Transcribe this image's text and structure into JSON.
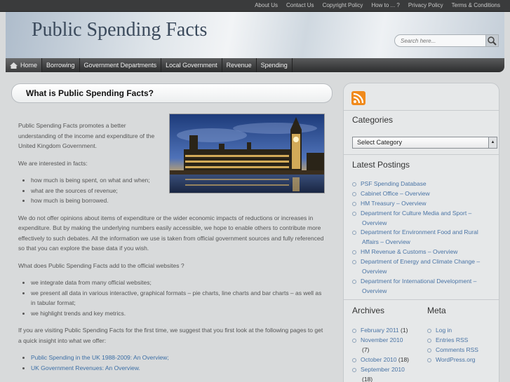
{
  "topnav": [
    "About Us",
    "Contact Us",
    "Copyright Policy",
    "How to ... ?",
    "Privacy Policy",
    "Terms & Conditions"
  ],
  "site": {
    "title": "Public Spending Facts"
  },
  "search": {
    "placeholder": "Search here..."
  },
  "mainnav": [
    "Home",
    "Borrowing",
    "Government Departments",
    "Local Government",
    "Revenue",
    "Spending"
  ],
  "content": {
    "heading": "What is Public Spending Facts?",
    "p1": "Public Spending Facts promotes a better understanding of the income and expenditure of the United Kingdom Government.",
    "p2": "We are interested in facts:",
    "facts": [
      "how much is being spent, on what and when;",
      "what are the sources of revenue;",
      "how much is being borrowed."
    ],
    "p3": "We do not offer opinions about items of expenditure or the wider economic impacts of reductions or increases in expenditure. But by making the underlying numbers easily accessible, we hope to enable others to contribute more effectively to such debates. All the information we use is taken from official government sources and fully referenced so that you can explore the base data if you wish.",
    "p4": "What does Public Spending Facts add to the official websites ?",
    "adds": [
      "we integrate data from many official websites;",
      "we present all data in various interactive, graphical formats – pie charts, line charts and bar charts – as well as in tabular format;",
      "we highlight trends and key metrics."
    ],
    "p5": "If you are visiting Public Spending Facts for the first time, we suggest that you first look at the following pages to get a quick insight into what we offer:",
    "links": [
      "Public Spending in the UK 1988-2009: An Overview;",
      "UK Government Revenues: An Overview."
    ]
  },
  "sidebar": {
    "categories_title": "Categories",
    "select_value": "Select Category",
    "latest_title": "Latest Postings",
    "latest": [
      "PSF Spending Database",
      "Cabinet Office – Overview",
      "HM Treasury – Overview",
      "Department for Culture Media and Sport – Overview",
      "Department for Environment Food and Rural Affairs – Overview",
      "HM Revenue & Customs – Overview",
      "Department of Energy and Climate Change – Overview",
      "Department for International Development – Overview"
    ],
    "archives_title": "Archives",
    "archives": [
      {
        "label": "February 2011",
        "count": "(1)"
      },
      {
        "label": "November 2010",
        "count": "(7)"
      },
      {
        "label": "October 2010",
        "count": "(18)"
      },
      {
        "label": "September 2010",
        "count": "(18)"
      }
    ],
    "meta_title": "Meta",
    "meta": [
      "Log in",
      "Entries RSS",
      "Comments RSS",
      "WordPress.org"
    ]
  }
}
